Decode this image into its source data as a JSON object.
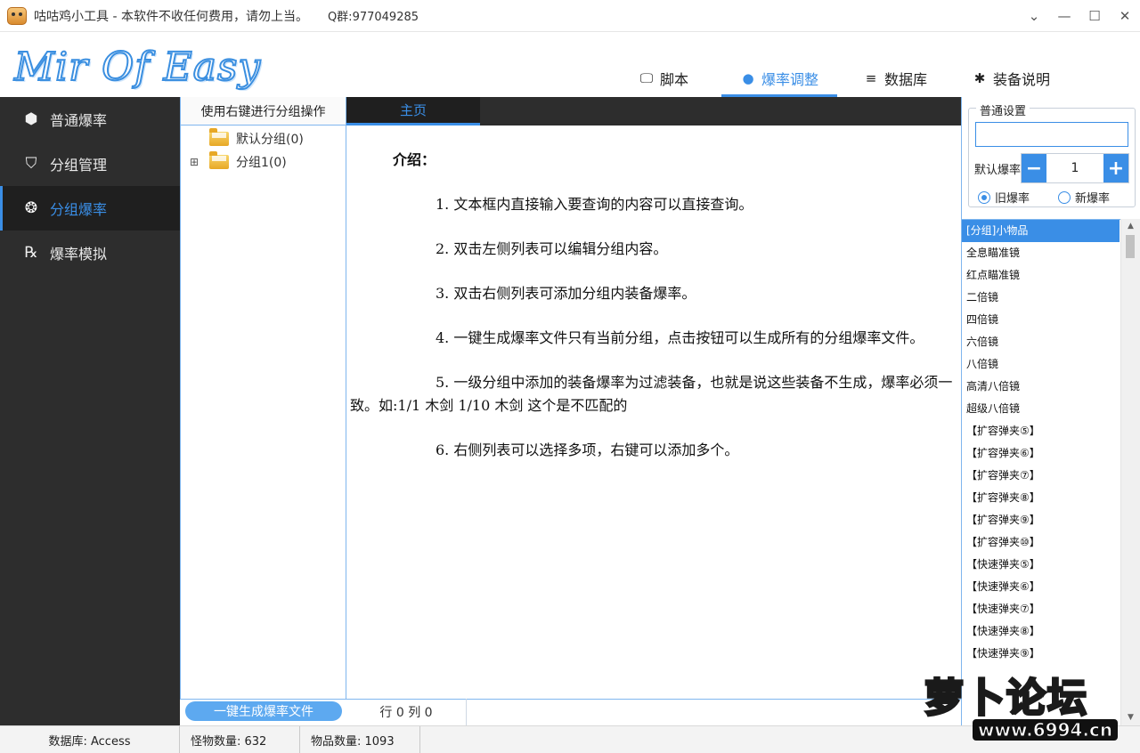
{
  "window": {
    "title": "咕咕鸡小工具 - 本软件不收任何费用，请勿上当。",
    "qq": "Q群:977049285",
    "controls": [
      "⌄",
      "—",
      "☐",
      "✕"
    ]
  },
  "header": {
    "logo": "Mir Of Easy",
    "tabs": [
      {
        "label": "脚本",
        "icon": "monitor-icon"
      },
      {
        "label": "爆率调整",
        "icon": "brain-icon"
      },
      {
        "label": "数据库",
        "icon": "database-icon"
      },
      {
        "label": "装备说明",
        "icon": "figure-icon"
      }
    ],
    "active_tab": 1
  },
  "sidebar": {
    "items": [
      {
        "label": "普通爆率",
        "icon": "cube-icon"
      },
      {
        "label": "分组管理",
        "icon": "shield-icon"
      },
      {
        "label": "分组爆率",
        "icon": "cluster-icon"
      },
      {
        "label": "爆率模拟",
        "icon": "prescription-icon"
      }
    ],
    "active": 2
  },
  "groups": {
    "header": "使用右键进行分组操作",
    "nodes": [
      {
        "label": "默认分组(0)",
        "expandable": false
      },
      {
        "label": "分组1(0)",
        "expandable": true
      }
    ],
    "generate_button": "一键生成爆率文件"
  },
  "content": {
    "tab": "主页",
    "title": "介绍：",
    "paragraphs": [
      "1. 文本框内直接输入要查询的内容可以直接查询。",
      "2. 双击左侧列表可以编辑分组内容。",
      "3. 双击右侧列表可添加分组内装备爆率。",
      "4. 一键生成爆率文件只有当前分组，点击按钮可以生成所有的分组爆率文件。",
      "5. 一级分组中添加的装备爆率为过滤装备，也就是说这些装备不生成，爆率必须一致。如:1/1 木剑     1/10 木剑  这个是不匹配的",
      "6. 右侧列表可以选择多项，右键可以添加多个。"
    ],
    "rowcol": "行 0 列 0"
  },
  "settings": {
    "legend": "普通设置",
    "search_value": "",
    "rate_label": "默认爆率",
    "rate_value": "1",
    "minus": "−",
    "plus": "+",
    "radio_old": "旧爆率",
    "radio_new": "新爆率",
    "radio_selected": "旧爆率"
  },
  "item_list": [
    "[分组]小物品",
    "全息瞄准镜",
    "红点瞄准镜",
    "二倍镜",
    "四倍镜",
    "六倍镜",
    "八倍镜",
    "高清八倍镜",
    "超级八倍镜",
    "【扩容弹夹⑤】",
    "【扩容弹夹⑥】",
    "【扩容弹夹⑦】",
    "【扩容弹夹⑧】",
    "【扩容弹夹⑨】",
    "【扩容弹夹⑩】",
    "【快速弹夹⑤】",
    "【快速弹夹⑥】",
    "【快速弹夹⑦】",
    "【快速弹夹⑧】",
    "【快速弹夹⑨】"
  ],
  "status": {
    "db": "数据库: Access",
    "monsters": "怪物数量: 632",
    "items": "物品数量: 1093"
  },
  "watermark": {
    "text": "萝卜论坛",
    "url": "www.6994.cn"
  },
  "colors": {
    "accent": "#3a8ee6",
    "sidebar_bg": "#2d2d2d",
    "watermark_yellow": "#ffd400"
  }
}
